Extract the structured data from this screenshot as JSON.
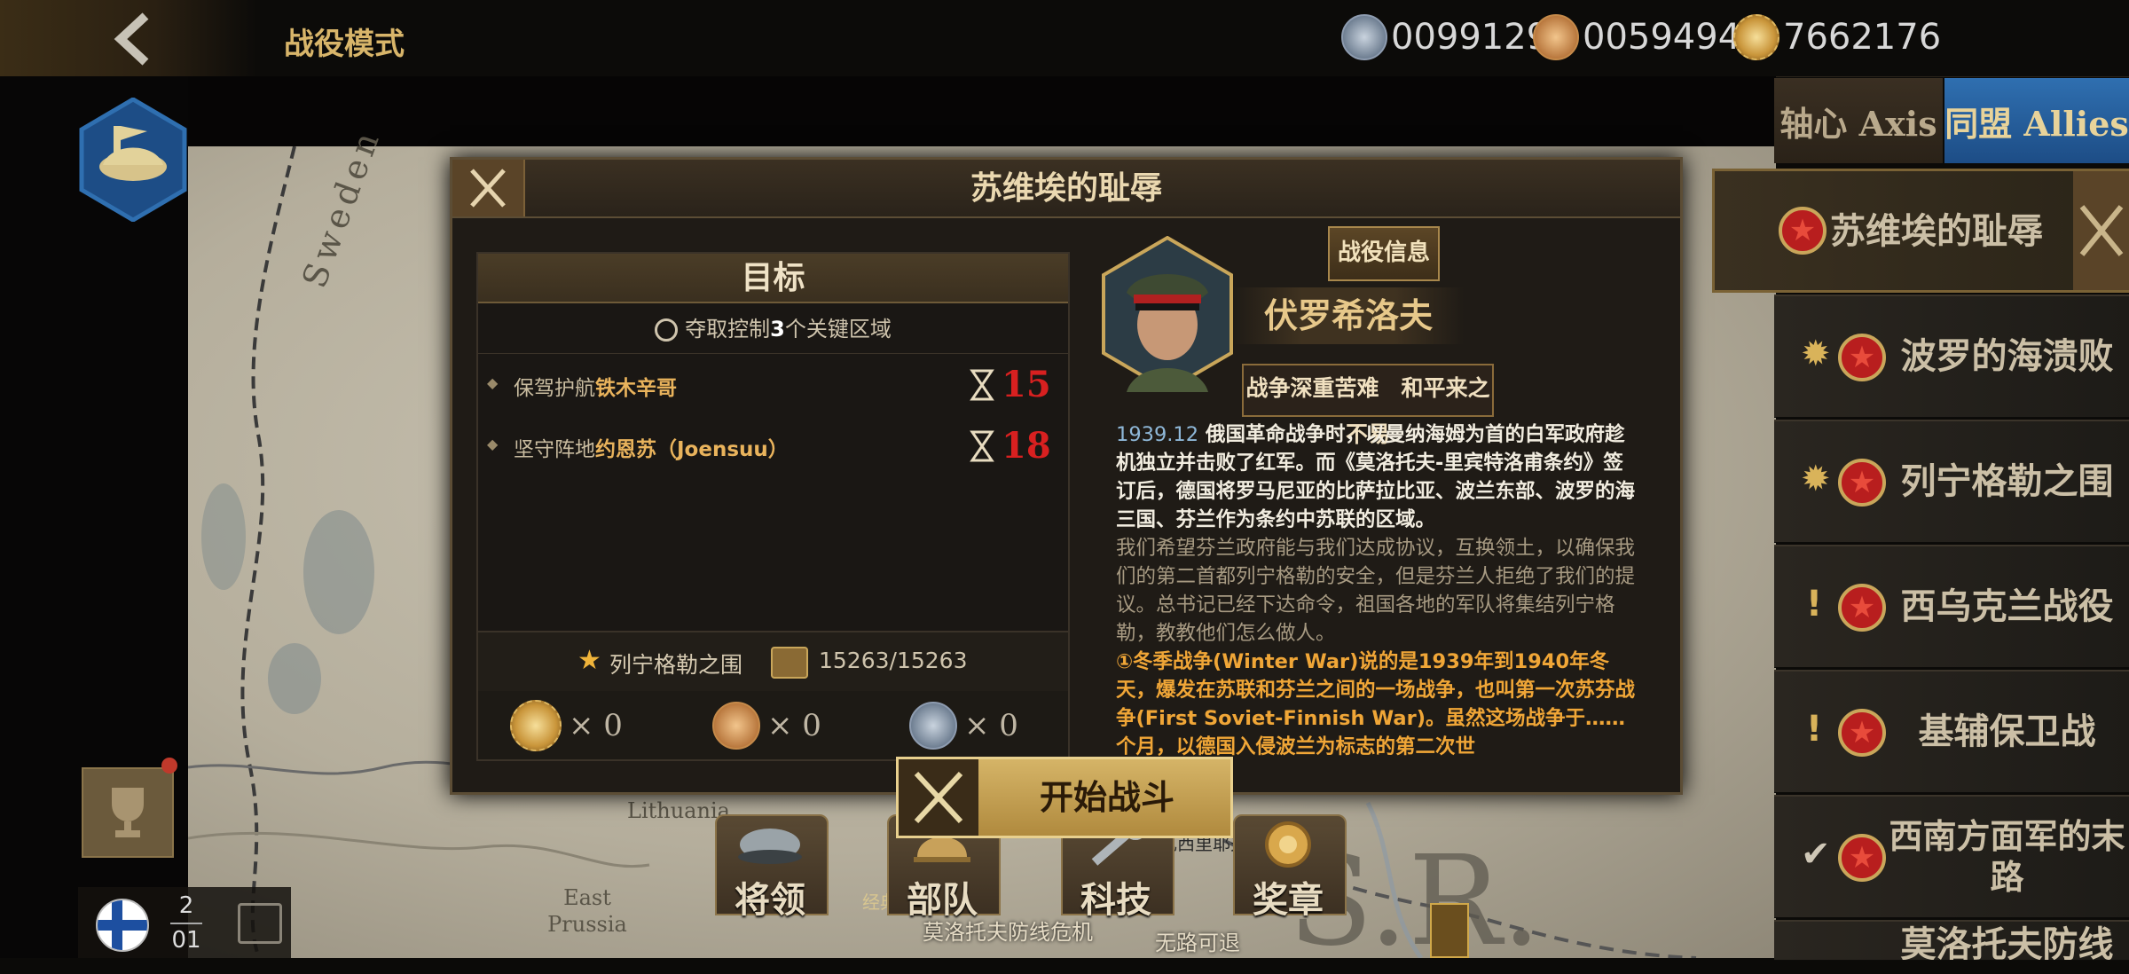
{
  "header": {
    "mode_title": "战役模式",
    "resources": [
      {
        "name": "silver-medal",
        "value": "0099129"
      },
      {
        "name": "bronze-medal",
        "value": "0059494"
      },
      {
        "name": "gold-sun-medal",
        "value": "7662176"
      }
    ]
  },
  "map": {
    "labels": [
      "Sweden",
      "Lithuania",
      "East Prussia",
      "S.R."
    ],
    "route_labels": [
      "莫洛托夫防线危机",
      "无路可退",
      "瓦西里耶夫斯克",
      "经典"
    ]
  },
  "side": {
    "tabs": {
      "axis": "轴心 Axis",
      "allies": "同盟 Allies"
    },
    "campaigns": [
      {
        "label": "苏维埃的耻辱",
        "active": true
      },
      {
        "label": "波罗的海溃败",
        "marker": "medal"
      },
      {
        "label": "列宁格勒之围",
        "marker": "medal"
      },
      {
        "label": "西乌克兰战役",
        "marker": "!"
      },
      {
        "label": "基辅保卫战",
        "marker": "!"
      },
      {
        "label": "西南方面军的末路",
        "marker": "✔"
      },
      {
        "label": "莫洛托夫防线"
      }
    ]
  },
  "turn": {
    "current": "2",
    "total": "01"
  },
  "dialog": {
    "title": "苏维埃的耻辱",
    "goal": {
      "heading": "目标",
      "subtitle_pre": "夺取控制",
      "subtitle_num": "3",
      "subtitle_post": "个关键区域",
      "tasks": [
        {
          "prefix": "保驾护航",
          "target": "铁木辛哥",
          "turns": "15"
        },
        {
          "prefix": "坚守阵地",
          "target": "约恩苏（Joensuu）",
          "turns": "18"
        }
      ],
      "unlock_name": "列宁格勒之围",
      "unlock_value": "15263/15263",
      "rewards": [
        {
          "icon": "gold-sun-medal-icon",
          "count": "0"
        },
        {
          "icon": "bronze-medal-icon",
          "count": "0"
        },
        {
          "icon": "silver-medal-icon",
          "count": "0"
        }
      ]
    },
    "info_button": "战役信息",
    "general_name": "伏罗希洛夫",
    "slogan": "战争深重苦难　和平来之不易",
    "story": {
      "date": "1939.12",
      "p1": "俄国革命战争时，以曼纳海姆为首的白军政府趁机独立并击败了红军。而《莫洛托夫-里宾特洛甫条约》签订后，德国将罗马尼亚的比萨拉比亚、波兰东部、波罗的海三国、芬兰作为条约中苏联的区域。",
      "p2": "我们希望芬兰政府能与我们达成协议，互换领土，以确保我们的第二首都列宁格勒的安全，但是芬兰人拒绝了我们的提议。总书记已经下达命令，祖国各地的军队将集结列宁格勒，教教他们怎么做人。",
      "p3": "①冬季战争(Winter War)说的是1939年到1940年冬天，爆发在苏联和芬兰之间的一场战争，也叫第一次苏芬战争(First Soviet-Finnish War)。虽然这场战争于……个月，以德国入侵波兰为标志的第二次世"
    },
    "start_button": "开始战斗"
  },
  "bottom_menu": [
    "将领",
    "部队",
    "科技",
    "奖章"
  ],
  "colors": {
    "accent_gold": "#d8b56a",
    "allies_blue": "#2f6fb0",
    "turn_red": "#d82020",
    "story_orange": "#f0a637"
  }
}
